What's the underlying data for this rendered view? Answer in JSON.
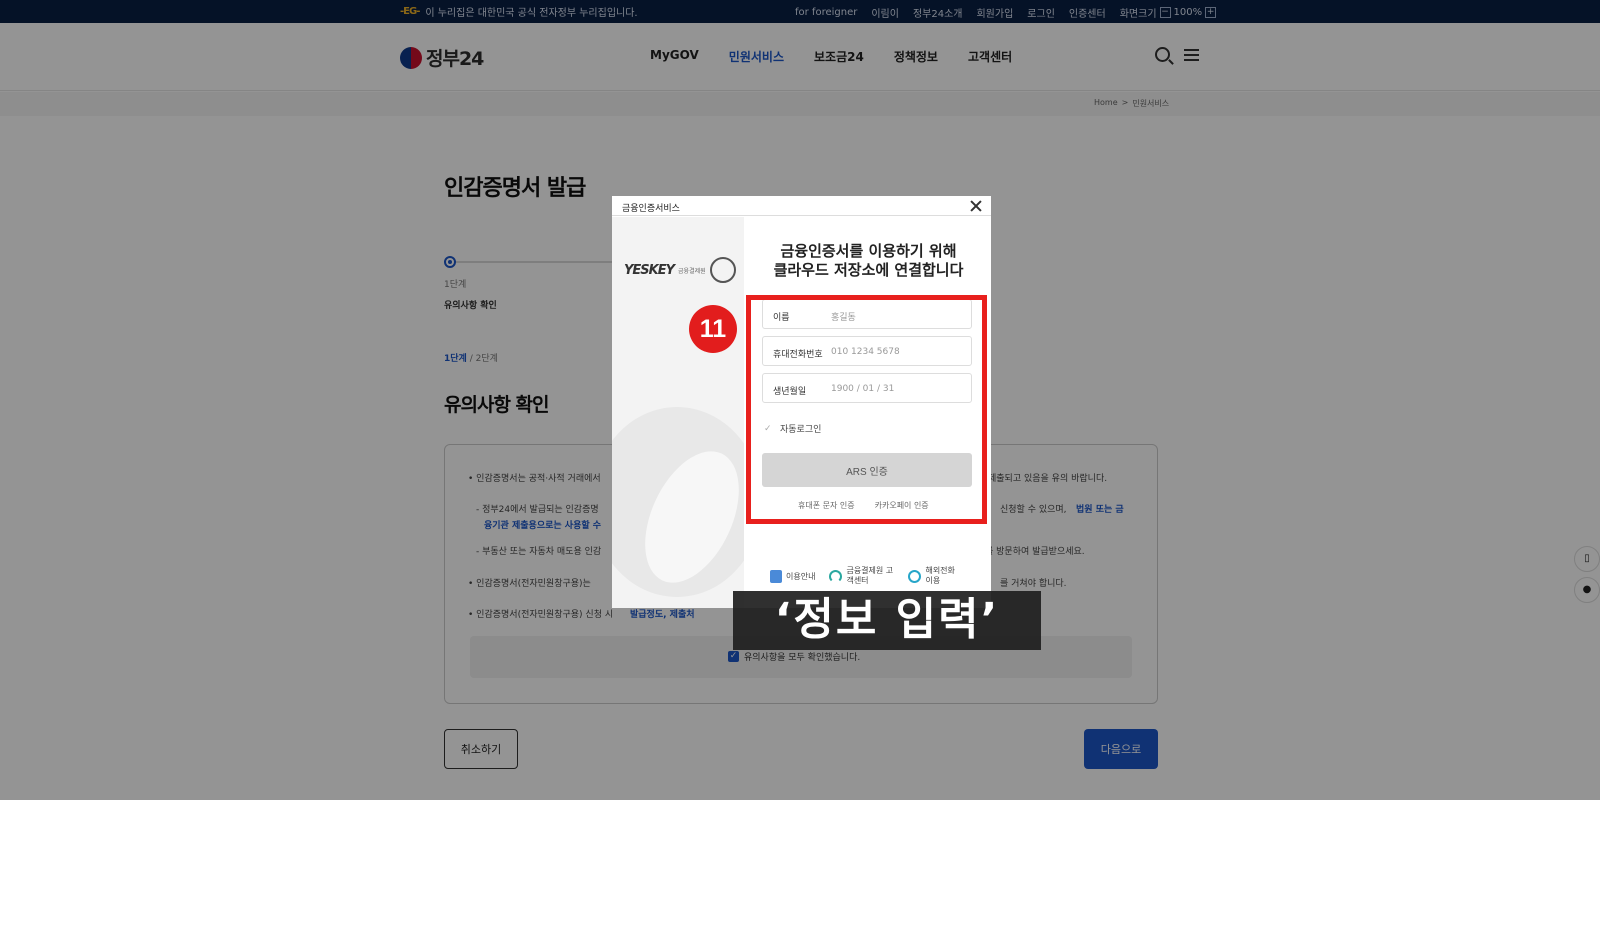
{
  "topbar": {
    "notice": "이 누리집은 대한민국 공식 전자정부 누리집입니다.",
    "for_foreigner": "for foreigner",
    "links": [
      "이림이",
      "정부24소개",
      "회원가입",
      "로그인",
      "인증센터",
      "화면크기"
    ],
    "zoom": "100%",
    "zoom_minus": "−",
    "zoom_plus": "+"
  },
  "header": {
    "logo": "정부24",
    "nav": [
      "MyGOV",
      "민원서비스",
      "보조금24",
      "정책정보",
      "고객센터"
    ],
    "active_nav": "민원서비스"
  },
  "breadcrumb": {
    "home": "Home",
    "sep": ">",
    "current": "민원서비스"
  },
  "page": {
    "title": "인감증명서 발급",
    "step_number": "1단계",
    "step_name": "유의사항 확인",
    "step_current": "1단계",
    "step_total": "/ 2단계",
    "section_title": "유의사항 확인",
    "notices": [
      "• 인감증명서는 공적·사적 거래에서",
      "- 정부24에서 발급되는 인감증명",
      "- 부동산 또는 자동차 매도용 인감",
      "• 인감증명서(전자민원창구용)는",
      "• 인감증명서(전자민원창구용) 신청 시"
    ],
    "notice_right_1": "제출되고 있음을 유의 바랍니다.",
    "notice_right_2": "신청할 수 있으며,",
    "notice_right_2_hl": "법원 또는 금",
    "notice_cont_2": "융기관 제출용으로는 사용할 수",
    "notice_right_3": "를 방문하여 발급받으세요.",
    "notice_right_4": "를 거쳐야 합니다.",
    "notice_hl_5": "발급정도, 제출처",
    "confirm": "유의사항을 모두 확인했습니다.",
    "cancel": "취소하기",
    "next": "다음으로"
  },
  "modal": {
    "title": "금융인증서비스",
    "brand": "YESKEY",
    "brand_sub": "금융결제원",
    "heading_line1": "금융인증서를 이용하기 위해",
    "heading_line2": "클라우드 저장소에 연결합니다",
    "fields": [
      {
        "label": "이름",
        "placeholder": "홍길동"
      },
      {
        "label": "휴대전화번호",
        "placeholder": "010 1234 5678"
      },
      {
        "label": "생년월일",
        "placeholder": "1900 / 01 / 31"
      }
    ],
    "auto_login": "자동로그인",
    "ars_button": "ARS 인증",
    "alt_links": [
      "휴대폰 문자 인증",
      "카카오페이 인증"
    ],
    "footer_links": [
      {
        "label": "이용안내",
        "icon": "document-icon"
      },
      {
        "label": "금융결제원 고객센터",
        "icon": "headset-icon"
      },
      {
        "label": "해외전화 이용",
        "icon": "globe-icon"
      }
    ]
  },
  "annotation": {
    "badge": "11",
    "caption": "‘정보 입력’",
    "highlight_color": "#e8201d"
  },
  "colors": {
    "brand": "#1c57c9",
    "topbar": "#0a1f44"
  }
}
